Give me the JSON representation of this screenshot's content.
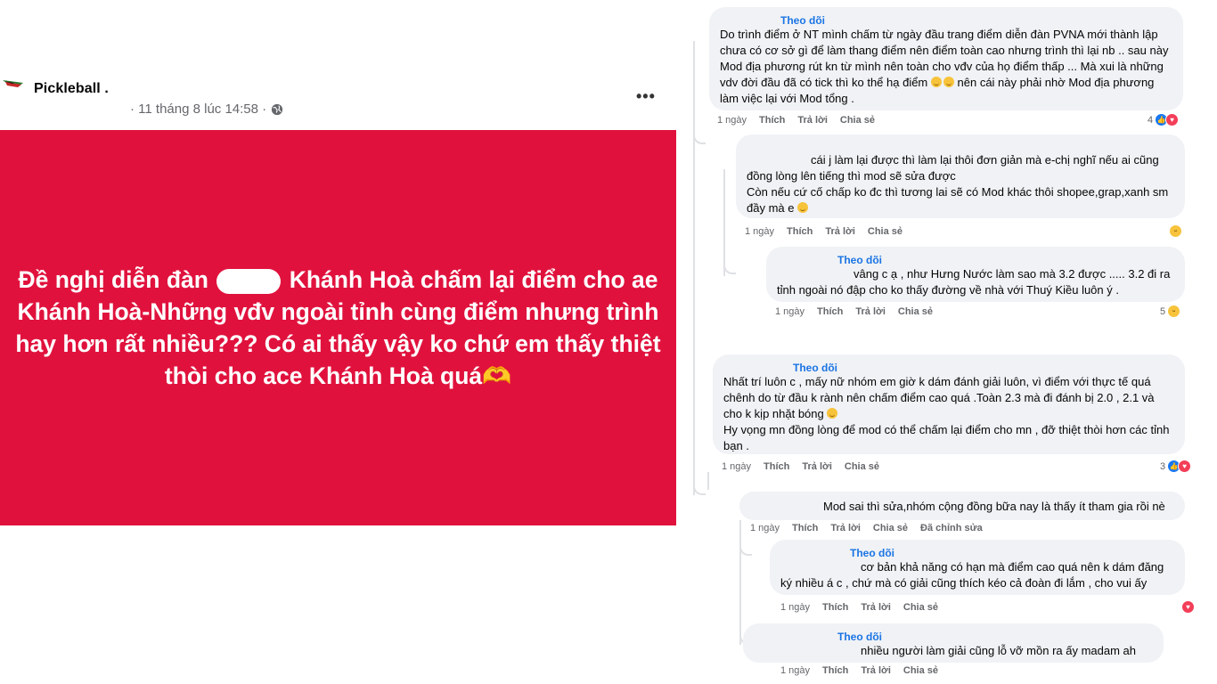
{
  "post": {
    "group_name": "Pickleball .",
    "timestamp": "· 11 tháng 8 lúc 14:58 ·",
    "more_icon": "more-horizontal-icon",
    "privacy_icon": "globe-icon",
    "image_text_line1_part1": "Đề nghị diễn đàn",
    "image_text_line1_part2": "Khánh Hoà chấm lại điểm cho ae",
    "image_text_line2": "Khánh Hoà-Những vđv ngoài tỉnh cùng điểm nhưng trình",
    "image_text_line3": "hay hơn rất nhiều??? Có ai thấy vậy ko chứ em thấy thiệt",
    "image_text_line4": "thòi cho ace Khánh Hoà quá🫶",
    "image_bg_color": "#e0123d"
  },
  "comments": [
    {
      "follow": "Theo dõi",
      "text": "Do trình điểm ở NT mình chấm từ ngày đầu trang điểm diễn đàn PVNA mới thành lập chưa có cơ sở gì để làm thang điểm nên điểm toàn cao nhưng trình thì lại nb .. sau này Mod địa phương rút kn từ mình nên toàn cho vđv của họ điểm thấp ... Mà xui là những vdv đời đầu đã có tick thì ko thể hạ điểm",
      "text_after": "nên cái này phải nhờ Mod địa phương làm việc lại với Mod tổng .",
      "time": "1 ngày",
      "like": "Thích",
      "reply": "Trả lời",
      "share": "Chia sẻ",
      "react_count": "4"
    },
    {
      "text": "cái j làm lại được thì làm lại thôi đơn giản mà e-chị nghĩ nếu ai cũng đồng lòng lên tiếng thì mod sẽ sửa được",
      "text2": "Còn nếu cứ cố chấp ko đc thì tương lai sẽ có Mod khác thôi shopee,grap,xanh sm đầy mà e",
      "time": "1 ngày",
      "like": "Thích",
      "reply": "Trả lời",
      "share": "Chia sẻ"
    },
    {
      "follow": "Theo dõi",
      "text": "vâng c ạ , như Hưng Nước làm sao mà 3.2 được ..... 3.2 đi ra tỉnh ngoài nó đập cho ko thấy đường về nhà với Thuý Kiều luôn ý .",
      "time": "1 ngày",
      "like": "Thích",
      "reply": "Trả lời",
      "share": "Chia sẻ",
      "react_count": "5"
    },
    {
      "follow": "Theo dõi",
      "text": "Nhất trí luôn c , mấy nữ nhóm em giờ k dám đánh giải luôn, vì điểm với thực tế quá chênh do từ đầu k rành nên chấm điểm cao quá .Toàn 2.3 mà đi đánh bị 2.0 , 2.1 và cho k kịp nhặt bóng",
      "text2": "Hy vọng mn đồng lòng để mod có thể chấm lại điểm cho mn , đỡ thiệt thòi hơn các tỉnh bạn .",
      "time": "1 ngày",
      "like": "Thích",
      "reply": "Trả lời",
      "share": "Chia sẻ",
      "react_count": "3"
    },
    {
      "text": "Mod sai thì sửa,nhóm cộng đồng bữa nay là thấy ít tham gia rồi nè",
      "time": "1 ngày",
      "like": "Thích",
      "reply": "Trả lời",
      "share": "Chia sẻ",
      "edit": "Đã chỉnh sửa"
    },
    {
      "follow": "Theo dõi",
      "text": "cơ bản khả năng có hạn mà điểm cao quá nên k dám đăng ký nhiều á c , chứ mà có giải cũng thích kéo cả đoàn đi lắm , cho vui ấy",
      "time": "1 ngày",
      "like": "Thích",
      "reply": "Trả lời",
      "share": "Chia sẻ"
    },
    {
      "follow": "Theo dõi",
      "text": "nhiều người làm giải cũng lỗ vỡ mồn ra ấy madam ah",
      "time": "1 ngày",
      "like": "Thích",
      "reply": "Trả lời",
      "share": "Chia sẻ"
    }
  ]
}
